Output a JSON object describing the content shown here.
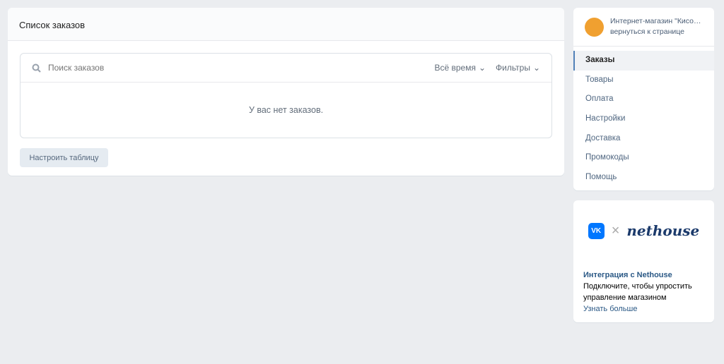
{
  "main": {
    "title": "Список заказов",
    "search_placeholder": "Поиск заказов",
    "period": "Всё время",
    "filters": "Фильтры",
    "empty": "У вас нет заказов.",
    "configure": "Настроить таблицу"
  },
  "shop": {
    "name": "Интернет-магазин \"Кисо…",
    "back": "вернуться к странице"
  },
  "menu": [
    {
      "label": "Заказы"
    },
    {
      "label": "Товары"
    },
    {
      "label": "Оплата"
    },
    {
      "label": "Настройки"
    },
    {
      "label": "Доставка"
    },
    {
      "label": "Промокоды"
    },
    {
      "label": "Помощь"
    }
  ],
  "promo": {
    "vk": "VK",
    "x": "×",
    "brand": "nethouse",
    "title": "Интеграция с Nethouse",
    "text": "Подключите, чтобы упростить управление магазином",
    "link": "Узнать больше"
  },
  "colors": {
    "accent": "#5181b8",
    "vk": "#0077ff"
  }
}
